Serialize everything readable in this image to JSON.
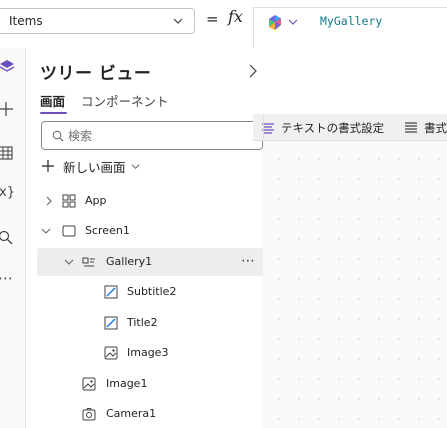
{
  "formula_bar": {
    "property": "Items",
    "equals": "=",
    "fx": "fx",
    "formula": "MyGallery"
  },
  "rail": {
    "icons": [
      "layers-icon",
      "plus-icon",
      "table-icon",
      "variables-icon",
      "search-icon",
      "more-icon"
    ],
    "variables_label": "x}",
    "more_label": "⋯"
  },
  "tree_panel": {
    "title": "ツリー ビュー",
    "tabs": [
      {
        "label": "画面",
        "active": true
      },
      {
        "label": "コンポーネント",
        "active": false
      }
    ],
    "search_placeholder": "検索",
    "new_screen_label": "新しい画面",
    "nodes": [
      {
        "label": "App",
        "icon": "app-icon",
        "expandable": true,
        "expanded": false,
        "selected": false
      },
      {
        "label": "Screen1",
        "icon": "screen-icon",
        "expandable": true,
        "expanded": true,
        "selected": false
      },
      {
        "label": "Gallery1",
        "icon": "gallery-icon",
        "expandable": true,
        "expanded": true,
        "selected": true,
        "more": "⋯"
      },
      {
        "label": "Subtitle2",
        "icon": "text-edit-icon",
        "expandable": false,
        "selected": false
      },
      {
        "label": "Title2",
        "icon": "text-edit-icon",
        "expandable": false,
        "selected": false
      },
      {
        "label": "Image3",
        "icon": "image-icon",
        "expandable": false,
        "selected": false
      },
      {
        "label": "Image1",
        "icon": "image-icon",
        "expandable": false,
        "selected": false
      },
      {
        "label": "Camera1",
        "icon": "camera-icon",
        "expandable": false,
        "selected": false
      }
    ]
  },
  "canvas_toolbar": {
    "format_text_label": "テキストの書式設定",
    "format_label": "書式"
  },
  "colors": {
    "accent": "#6b4fbb",
    "formula_text": "#0e7c86",
    "selected_row": "#ededed",
    "toolbar_bg": "#f0f0f0"
  }
}
